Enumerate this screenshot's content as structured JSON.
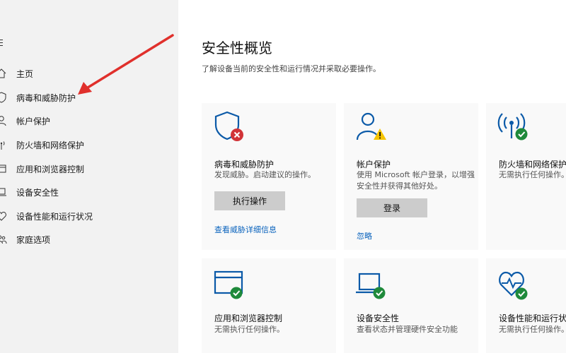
{
  "colors": {
    "accent": "#0a63bd",
    "shield_blue": "#0b5aa8",
    "status_ok": "#1f8a3b",
    "status_error": "#d13438",
    "status_warning": "#f5c400",
    "arrow": "#e0302c"
  },
  "sidebar": {
    "items": [
      {
        "label": "主页",
        "icon": "home-icon"
      },
      {
        "label": "病毒和威胁防护",
        "icon": "shield-icon"
      },
      {
        "label": "帐户保护",
        "icon": "person-icon"
      },
      {
        "label": "防火墙和网络保护",
        "icon": "wireless-icon"
      },
      {
        "label": "应用和浏览器控制",
        "icon": "app-window-icon"
      },
      {
        "label": "设备安全性",
        "icon": "laptop-icon"
      },
      {
        "label": "设备性能和运行状况",
        "icon": "heart-icon"
      },
      {
        "label": "家庭选项",
        "icon": "family-icon"
      }
    ]
  },
  "main": {
    "title": "安全性概览",
    "subtitle": "了解设备当前的安全性和运行情况并采取必要操作。",
    "cards": [
      {
        "title": "病毒和威胁防护",
        "desc": [
          "发现威胁。启动建议的操作。"
        ],
        "button": "执行操作",
        "link": "查看威胁详细信息",
        "icon": "shield-error-icon"
      },
      {
        "title": "帐户保护",
        "desc": [
          "使用 Microsoft 帐户登录，以增强",
          "安全性并获得其他好处。"
        ],
        "button": "登录",
        "link": "忽略",
        "icon": "person-warning-icon"
      },
      {
        "title": "防火墙和网络保护",
        "desc": [
          "无需执行任何操作。"
        ],
        "icon": "wireless-ok-icon"
      },
      {
        "title": "应用和浏览器控制",
        "desc": [
          "无需执行任何操作。"
        ],
        "icon": "app-window-ok-icon"
      },
      {
        "title": "设备安全性",
        "desc": [
          "查看状态并管理硬件安全功能"
        ],
        "icon": "laptop-ok-icon"
      },
      {
        "title": "设备性能和运行状况",
        "desc": [
          "无需执行任何操作。"
        ],
        "icon": "heart-ok-icon"
      }
    ]
  }
}
